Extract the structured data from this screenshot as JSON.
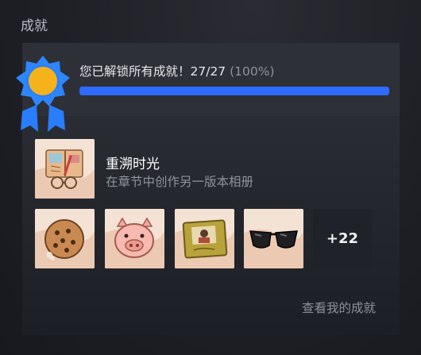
{
  "section": {
    "title": "成就"
  },
  "summary": {
    "text": "您已解锁所有成就！27/27",
    "percent_text": "(100%)",
    "progress": 1.0,
    "bar_color": "#2f6bff"
  },
  "featured": {
    "name": "重溯时光",
    "description": "在章节中创作另一版本相册",
    "icon": "photo-album-icon"
  },
  "badges": [
    {
      "icon": "cookie-icon"
    },
    {
      "icon": "pig-icon"
    },
    {
      "icon": "photo-frame-icon"
    },
    {
      "icon": "sunglasses-icon"
    }
  ],
  "more_count": "+22",
  "view_link": "查看我的成就",
  "medal_icon": "medal-icon"
}
